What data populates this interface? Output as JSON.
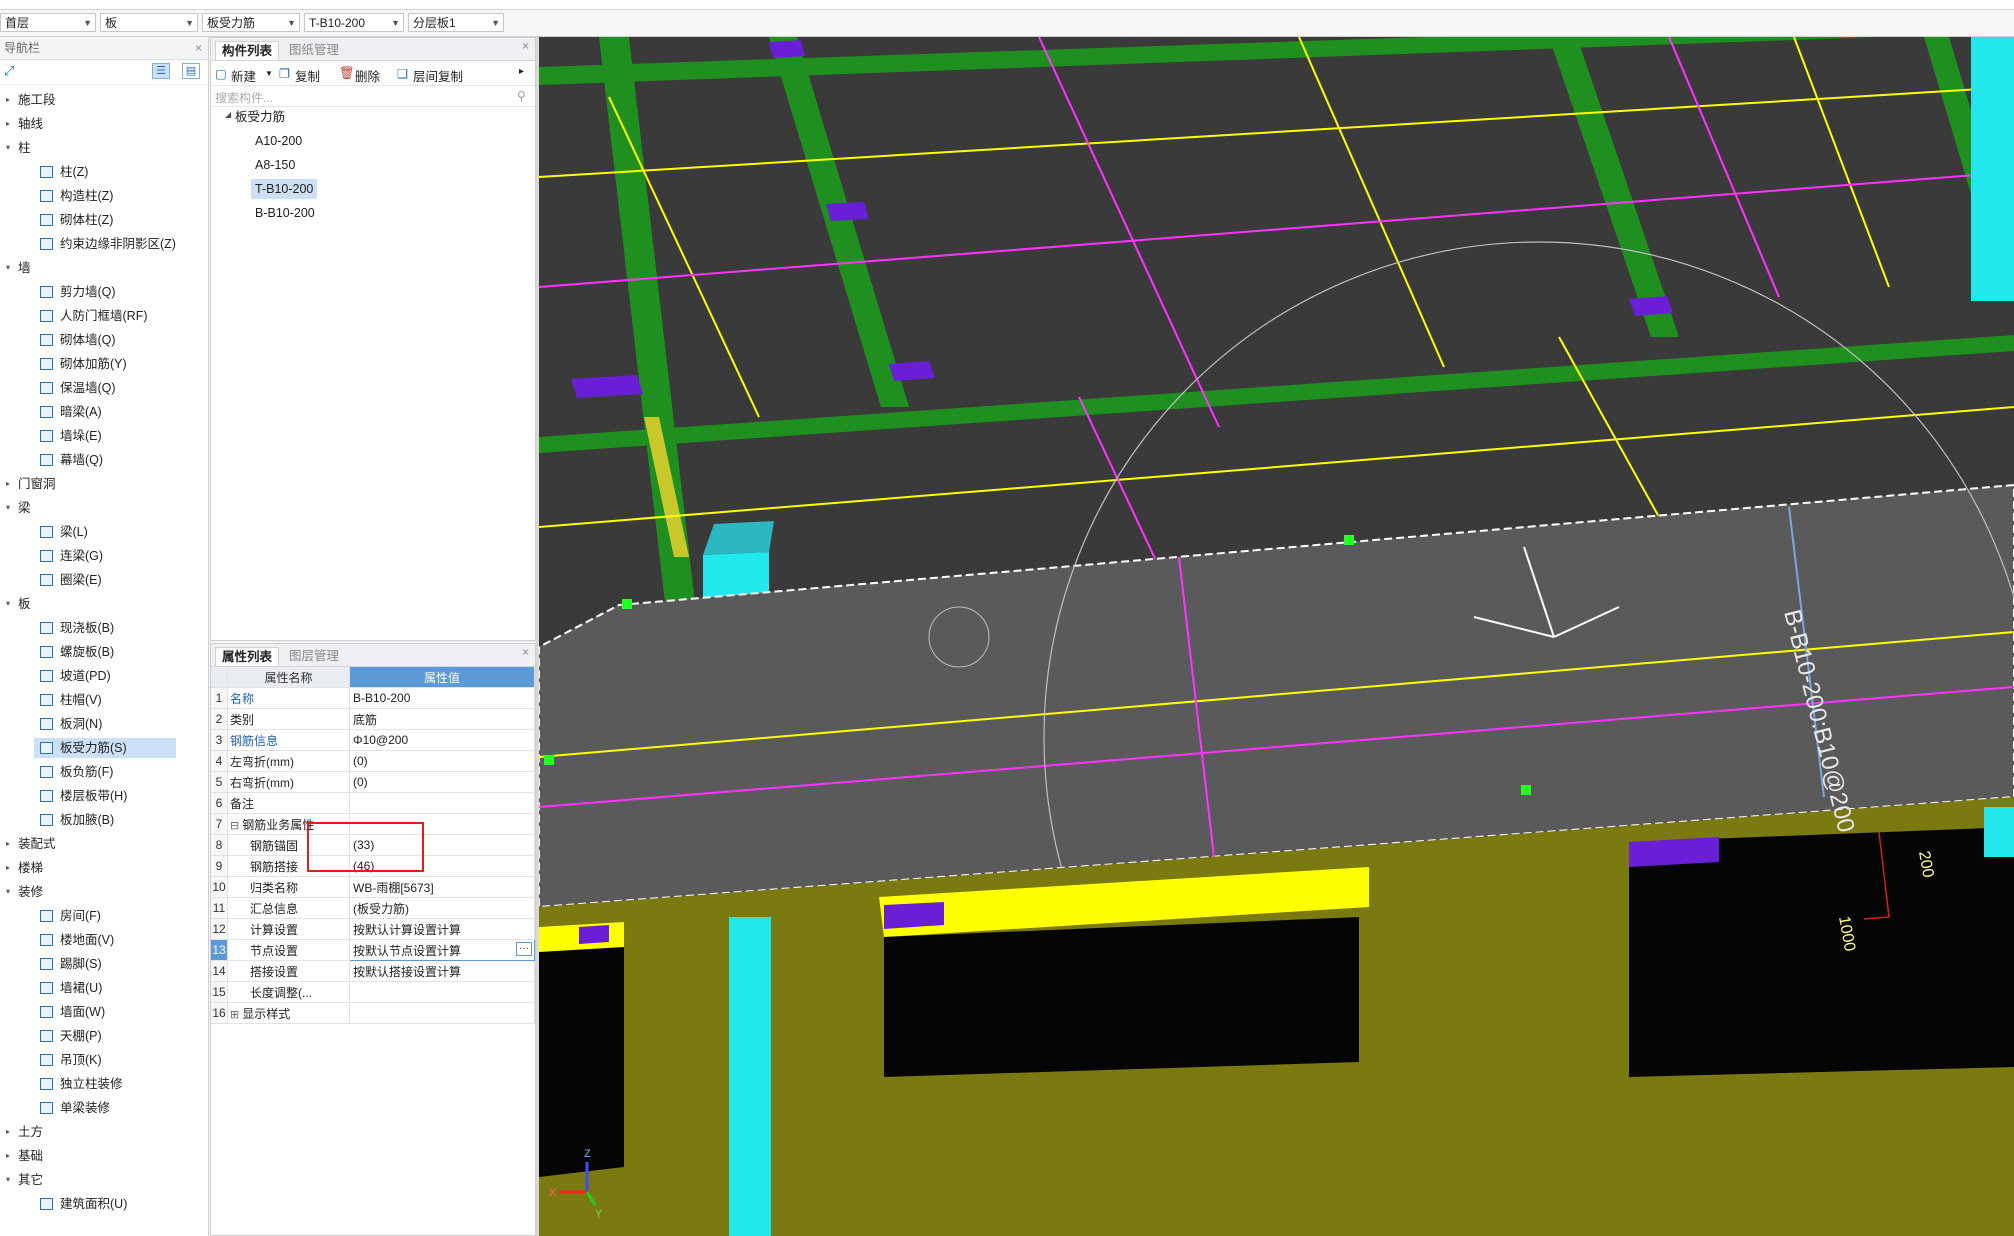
{
  "toolbar": {
    "floor": "首层",
    "category": "板",
    "type": "板受力筋",
    "component": "T-B10-200",
    "layer": "分层板1"
  },
  "nav": {
    "title": "导航栏",
    "items": [
      {
        "label": "施工段",
        "level": 0
      },
      {
        "label": "轴线",
        "level": 0
      },
      {
        "label": "柱",
        "level": 0,
        "open": true
      },
      {
        "label": "柱(Z)",
        "level": 1
      },
      {
        "label": "构造柱(Z)",
        "level": 1
      },
      {
        "label": "砌体柱(Z)",
        "level": 1
      },
      {
        "label": "约束边缘非阴影区(Z)",
        "level": 1
      },
      {
        "label": "墙",
        "level": 0,
        "open": true
      },
      {
        "label": "剪力墙(Q)",
        "level": 1
      },
      {
        "label": "人防门框墙(RF)",
        "level": 1
      },
      {
        "label": "砌体墙(Q)",
        "level": 1
      },
      {
        "label": "砌体加筋(Y)",
        "level": 1
      },
      {
        "label": "保温墙(Q)",
        "level": 1
      },
      {
        "label": "暗梁(A)",
        "level": 1
      },
      {
        "label": "墙垛(E)",
        "level": 1
      },
      {
        "label": "幕墙(Q)",
        "level": 1
      },
      {
        "label": "门窗洞",
        "level": 0
      },
      {
        "label": "梁",
        "level": 0,
        "open": true
      },
      {
        "label": "梁(L)",
        "level": 1
      },
      {
        "label": "连梁(G)",
        "level": 1
      },
      {
        "label": "圈梁(E)",
        "level": 1
      },
      {
        "label": "板",
        "level": 0,
        "open": true
      },
      {
        "label": "现浇板(B)",
        "level": 1
      },
      {
        "label": "螺旋板(B)",
        "level": 1
      },
      {
        "label": "坡道(PD)",
        "level": 1
      },
      {
        "label": "柱帽(V)",
        "level": 1
      },
      {
        "label": "板洞(N)",
        "level": 1
      },
      {
        "label": "板受力筋(S)",
        "level": 1,
        "selected": true
      },
      {
        "label": "板负筋(F)",
        "level": 1
      },
      {
        "label": "楼层板带(H)",
        "level": 1
      },
      {
        "label": "板加腋(B)",
        "level": 1
      },
      {
        "label": "装配式",
        "level": 0
      },
      {
        "label": "楼梯",
        "level": 0
      },
      {
        "label": "装修",
        "level": 0,
        "open": true
      },
      {
        "label": "房间(F)",
        "level": 1
      },
      {
        "label": "楼地面(V)",
        "level": 1
      },
      {
        "label": "踢脚(S)",
        "level": 1
      },
      {
        "label": "墙裙(U)",
        "level": 1
      },
      {
        "label": "墙面(W)",
        "level": 1
      },
      {
        "label": "天棚(P)",
        "level": 1
      },
      {
        "label": "吊顶(K)",
        "level": 1
      },
      {
        "label": "独立柱装修",
        "level": 1
      },
      {
        "label": "单梁装修",
        "level": 1
      },
      {
        "label": "土方",
        "level": 0
      },
      {
        "label": "基础",
        "level": 0
      },
      {
        "label": "其它",
        "level": 0,
        "open": true
      },
      {
        "label": "建筑面积(U)",
        "level": 1
      }
    ]
  },
  "component_panel": {
    "tab_active": "构件列表",
    "tab_inactive": "图纸管理",
    "new_label": "新建",
    "copy_label": "复制",
    "delete_label": "删除",
    "floor_copy_label": "层间复制",
    "search_placeholder": "搜索构件...",
    "root": "板受力筋",
    "items": [
      "A10-200",
      "A8-150",
      "T-B10-200",
      "B-B10-200"
    ]
  },
  "property_panel": {
    "tab_active": "属性列表",
    "tab_inactive": "图层管理",
    "col_name": "属性名称",
    "col_value": "属性值",
    "rows": [
      {
        "n": "1",
        "name": "名称",
        "value": "B-B10-200",
        "link": true
      },
      {
        "n": "2",
        "name": "类别",
        "value": "底筋"
      },
      {
        "n": "3",
        "name": "钢筋信息",
        "value": "Φ10@200",
        "link": true
      },
      {
        "n": "4",
        "name": "左弯折(mm)",
        "value": "(0)"
      },
      {
        "n": "5",
        "name": "右弯折(mm)",
        "value": "(0)"
      },
      {
        "n": "6",
        "name": "备注",
        "value": ""
      },
      {
        "n": "7",
        "name": "钢筋业务属性",
        "value": "",
        "group": true
      },
      {
        "n": "8",
        "name": "钢筋锚固",
        "value": "(33)",
        "child": true
      },
      {
        "n": "9",
        "name": "钢筋搭接",
        "value": "(46)",
        "child": true
      },
      {
        "n": "10",
        "name": "归类名称",
        "value": "WB-雨棚[5673]",
        "child": true
      },
      {
        "n": "11",
        "name": "汇总信息",
        "value": "(板受力筋)",
        "child": true
      },
      {
        "n": "12",
        "name": "计算设置",
        "value": "按默认计算设置计算",
        "child": true
      },
      {
        "n": "13",
        "name": "节点设置",
        "value": "按默认节点设置计算",
        "child": true,
        "active": true
      },
      {
        "n": "14",
        "name": "搭接设置",
        "value": "按默认搭接设置计算",
        "child": true
      },
      {
        "n": "15",
        "name": "长度调整(...",
        "value": "",
        "child": true
      },
      {
        "n": "16",
        "name": "显示样式",
        "value": "",
        "group": true,
        "collapsed": true
      }
    ]
  },
  "viewport": {
    "rebar_label": "B-B10-200:B10@200",
    "dim_label_1": "1000",
    "dim_label_2": "200",
    "axis_z": "Z",
    "axis_x": "X",
    "axis_y": "Y",
    "colors": {
      "slab": "#5a5a5a",
      "beam_green": "#1f8f1f",
      "yellow": "#ffff00",
      "magenta": "#ff33ff",
      "cyan": "#22e8ee",
      "purple": "#6a1fd6",
      "olive": "#7a7a10"
    }
  }
}
